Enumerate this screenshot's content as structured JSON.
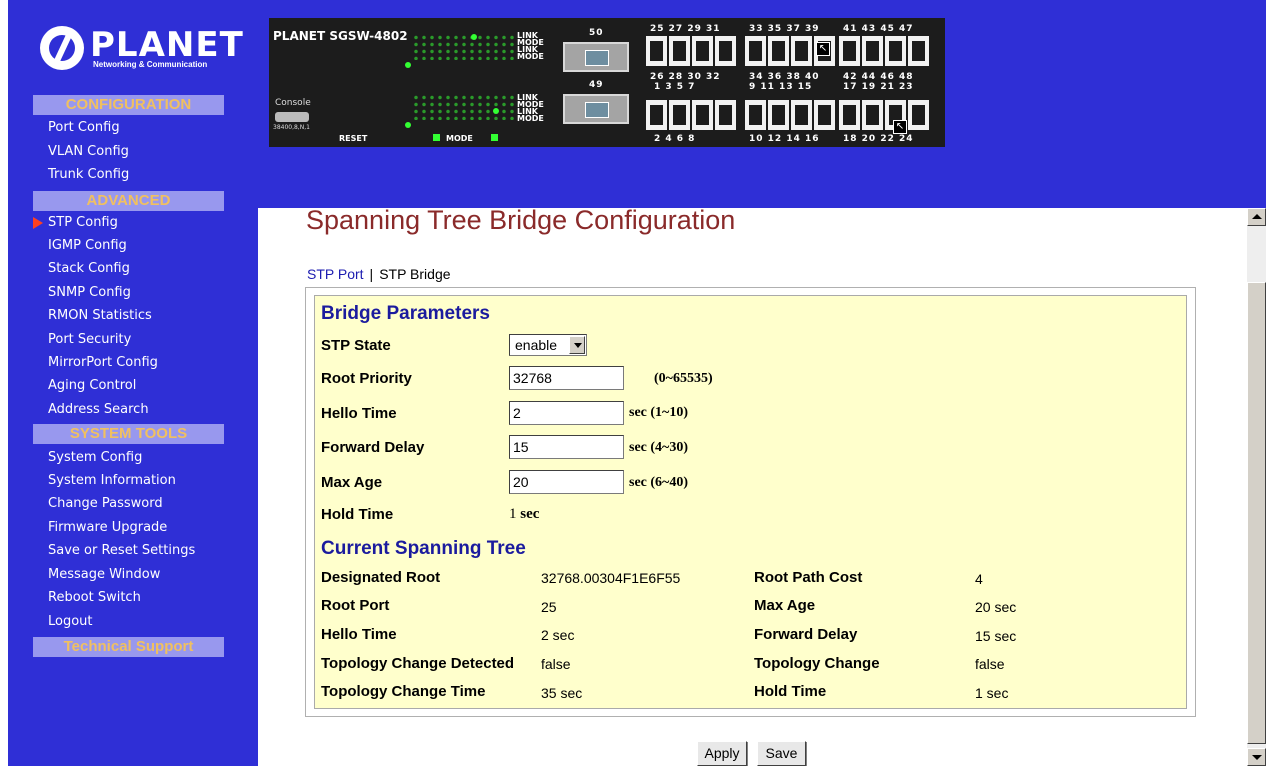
{
  "logo": {
    "name": "PLANET",
    "tagline": "Networking & Communication"
  },
  "sidebar": {
    "sections": [
      {
        "title": "CONFIGURATION",
        "items": [
          "Port Config",
          "VLAN Config",
          "Trunk Config"
        ]
      },
      {
        "title": "ADVANCED",
        "items": [
          "STP Config",
          "IGMP Config",
          "Stack Config",
          "SNMP Config",
          "RMON Statistics",
          "Port Security",
          "MirrorPort Config",
          "Aging Control",
          "Address Search"
        ]
      },
      {
        "title": "SYSTEM TOOLS",
        "items": [
          "System Config",
          "System Information",
          "Change Password",
          "Firmware Upgrade",
          "Save or Reset Settings",
          "Message Window",
          "Reboot Switch",
          "Logout"
        ]
      },
      {
        "title": "Technical Support",
        "items": []
      }
    ],
    "active_item": "STP Config"
  },
  "device_panel": {
    "brand": "PLANET SGSW-4802",
    "led_labels": [
      "LINK",
      "MODE",
      "LINK",
      "MODE"
    ],
    "led_labels_lower": [
      "LINK",
      "MODE",
      "LINK",
      "MODE"
    ],
    "console_label": "Console",
    "console_setting": "38400,8,N,1",
    "reset_label": "RESET",
    "mode_label": "MODE",
    "sfp_top": "50",
    "sfp_bottom": "49",
    "ports_top_odd": [
      "25 27  29 31",
      "33  35  37 39",
      "41 43  45  47"
    ],
    "ports_top_even": [
      "26  28  30  32",
      "34  36  38 40",
      "42  44  46  48"
    ],
    "ports_mid_odd": [
      "1   3   5   7",
      "9  11  13  15",
      "17  19  21  23"
    ],
    "ports_bottom_even": [
      "2   4   6   8",
      "10  12  14  16",
      "18  20  22  24"
    ]
  },
  "page": {
    "title": "Spanning Tree Bridge Configuration",
    "tabs": {
      "stp_port": "STP Port",
      "separator": "|",
      "stp_bridge": "STP Bridge"
    }
  },
  "bridge_parameters": {
    "heading": "Bridge Parameters",
    "stp_state": {
      "label": "STP State",
      "value": "enable"
    },
    "root_priority": {
      "label": "Root Priority",
      "value": "32768",
      "range": "(0~65535)"
    },
    "hello_time": {
      "label": "Hello Time",
      "value": "2",
      "range": "sec (1~10)"
    },
    "forward_delay": {
      "label": "Forward Delay",
      "value": "15",
      "range": "sec (4~30)"
    },
    "max_age": {
      "label": "Max Age",
      "value": "20",
      "range": "sec (6~40)"
    },
    "hold_time": {
      "label": "Hold Time",
      "value": "1",
      "unit": "sec"
    }
  },
  "current_tree": {
    "heading": "Current Spanning Tree",
    "left": [
      {
        "label": "Designated Root",
        "value": "32768.00304F1E6F55"
      },
      {
        "label": "Root Port",
        "value": "25"
      },
      {
        "label": "Hello Time",
        "value": "2 sec"
      },
      {
        "label": "Topology Change Detected",
        "value": "false"
      },
      {
        "label": "Topology Change Time",
        "value": "35 sec"
      }
    ],
    "right": [
      {
        "label": "Root Path Cost",
        "value": "4"
      },
      {
        "label": "Max Age",
        "value": "20 sec"
      },
      {
        "label": "Forward Delay",
        "value": "15 sec"
      },
      {
        "label": "Topology Change",
        "value": "false"
      },
      {
        "label": "Hold Time",
        "value": "1 sec"
      }
    ]
  },
  "buttons": {
    "apply": "Apply",
    "save": "Save"
  },
  "colors": {
    "sidebar_bg": "#2f2fd6",
    "section_bg": "#9898ee",
    "section_text": "#f0c060",
    "title_text": "#8a2a2a",
    "heading_text": "#1b1b9e",
    "panel_bg": "#ffffcc"
  }
}
